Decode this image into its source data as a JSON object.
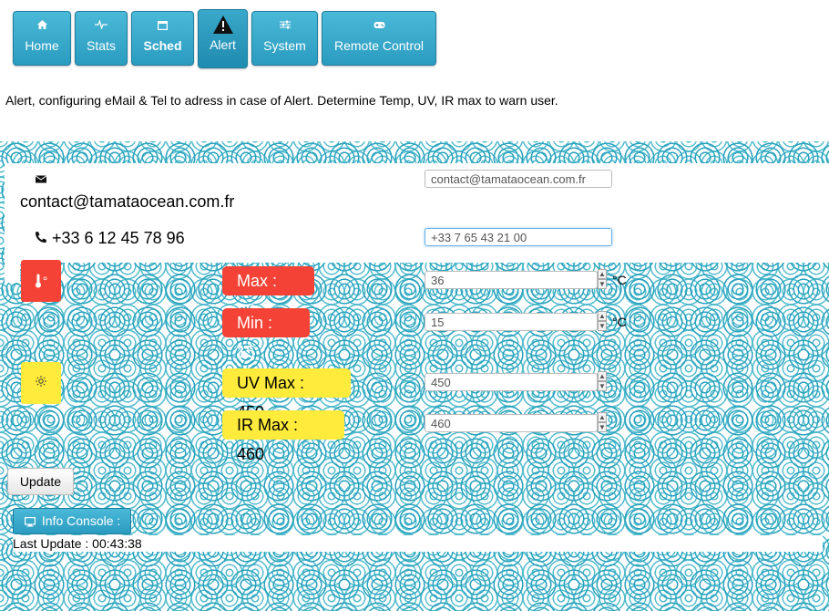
{
  "nav": {
    "items": [
      {
        "label": "Home",
        "icon": "home-icon"
      },
      {
        "label": "Stats",
        "icon": "pulse-icon"
      },
      {
        "label": "Sched",
        "icon": "calendar-icon"
      },
      {
        "label": "Alert",
        "icon": "warning-icon"
      },
      {
        "label": "System",
        "icon": "sliders-icon"
      },
      {
        "label": "Remote Control",
        "icon": "gamepad-icon"
      }
    ],
    "active": "Alert"
  },
  "intro_text": "Alert, configuring eMail & Tel to adress in case of Alert. Determine Temp, UV, IR max to warn user.",
  "contacts": {
    "email_label": "contact@tamataocean.com.fr",
    "email_value": "contact@tamataocean.com.fr",
    "phone_label": "+33 6 12 45 78 96",
    "phone_value": "+33 7 65 43 21 00"
  },
  "thresholds": {
    "temp_max_label": "Max : 36",
    "temp_max_value": "36",
    "temp_min_label": "Min : 15",
    "temp_min_value": "15",
    "temp_unit": "°C",
    "uv_max_label": "UV Max : 450",
    "uv_max_value": "450",
    "ir_max_label": "IR Max : 460",
    "ir_max_value": "460",
    "temp_icon_suffix": "°"
  },
  "actions": {
    "update_label": "Update",
    "console_label": "Info Console :"
  },
  "status": {
    "last_update": "Last Update : 00:43:38"
  },
  "colors": {
    "nav_blue": "#2a9cc0",
    "alert_red": "#f44336",
    "uv_yellow": "#ffeb3b",
    "swirl_teal": "#2ba3be"
  }
}
